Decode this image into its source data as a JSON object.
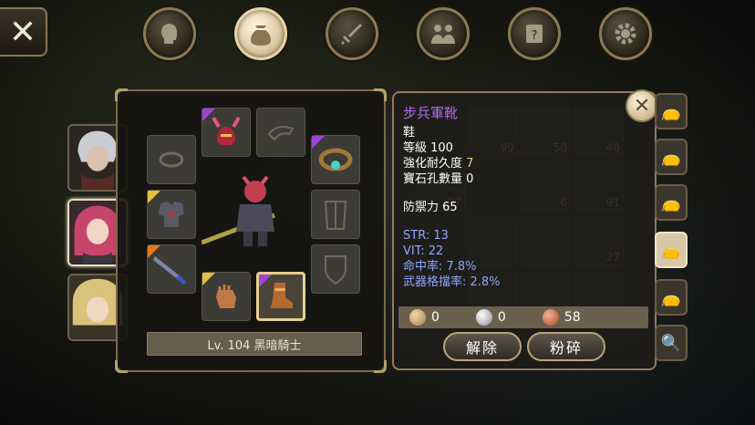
{
  "top_nav": [
    {
      "name": "character",
      "icon": "head-icon",
      "active": false
    },
    {
      "name": "bag",
      "icon": "bag-icon",
      "active": true
    },
    {
      "name": "skills",
      "icon": "sword-icon",
      "active": false
    },
    {
      "name": "party",
      "icon": "people-icon",
      "active": false
    },
    {
      "name": "quest",
      "icon": "scroll-icon",
      "active": false
    },
    {
      "name": "settings",
      "icon": "gear-icon",
      "active": false
    }
  ],
  "equipment": {
    "level_label": "Lv. 104 黑暗騎士",
    "slots": [
      {
        "name": "helmet",
        "icon": "horned-helmet-icon",
        "rarity": "purple",
        "empty": false
      },
      {
        "name": "cloak",
        "icon": "cloak-icon",
        "rarity": null,
        "empty": true
      },
      {
        "name": "amulet",
        "icon": "amulet-icon",
        "rarity": null,
        "empty": true
      },
      {
        "name": "earring",
        "icon": "gem-ring-icon",
        "rarity": "purple",
        "empty": false
      },
      {
        "name": "armor",
        "icon": "armor-icon",
        "rarity": "yellow",
        "empty": false
      },
      {
        "name": "shirt",
        "icon": "shirt-icon",
        "rarity": null,
        "empty": true
      },
      {
        "name": "weapon",
        "icon": "sword-icon",
        "rarity": "orange",
        "empty": false
      },
      {
        "name": "shield",
        "icon": "shield-icon",
        "rarity": null,
        "empty": true
      },
      {
        "name": "gloves",
        "icon": "gloves-icon",
        "rarity": "yellow",
        "empty": false
      },
      {
        "name": "boots",
        "icon": "boots-icon",
        "rarity": "purple",
        "empty": false,
        "selected": true
      }
    ]
  },
  "inventory_counts": [
    "99",
    "50",
    "40",
    "27",
    "6",
    "91",
    "27"
  ],
  "tooltip": {
    "item_name": "步兵軍靴",
    "type": "鞋",
    "level": "等級 100",
    "durability_label": "強化耐久度 ",
    "durability_value": "7",
    "gem_slots": "寶石孔數量 0",
    "defense": "防禦力 65",
    "str": "STR: 13",
    "vit": "VIT: 22",
    "hit_rate": "命中率: 7.8%",
    "block_rate": "武器格擋率: 2.8%"
  },
  "currency": {
    "gold": "0",
    "silver": "0",
    "copper": "58"
  },
  "buttons": {
    "unequip": "解除",
    "shatter": "粉碎"
  },
  "colors": {
    "rarity_purple": "#9d43d6",
    "rarity_yellow": "#e0c23c",
    "rarity_orange": "#e07a20",
    "item_name": "#b06cf0",
    "stat_blue": "#8da6ff"
  }
}
